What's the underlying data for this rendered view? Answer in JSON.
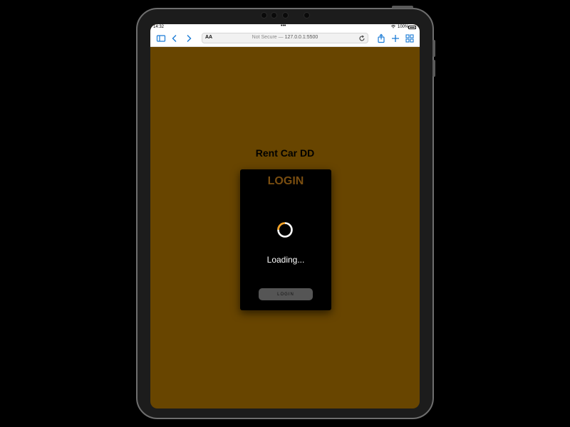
{
  "status_bar": {
    "time": "14:32",
    "battery_pct": "100%"
  },
  "browser": {
    "text_size_label": "AA",
    "security_label": "Not Secure —",
    "host": "127.0.0.1:5500",
    "toolbar_dots": "•••"
  },
  "page": {
    "app_title": "Rent Car DD",
    "background_color": "#684500",
    "login_card": {
      "title": "LOGIN",
      "loading_text": "Loading...",
      "button_label": "LOGIN",
      "spinner_color": "#f5a020"
    }
  }
}
